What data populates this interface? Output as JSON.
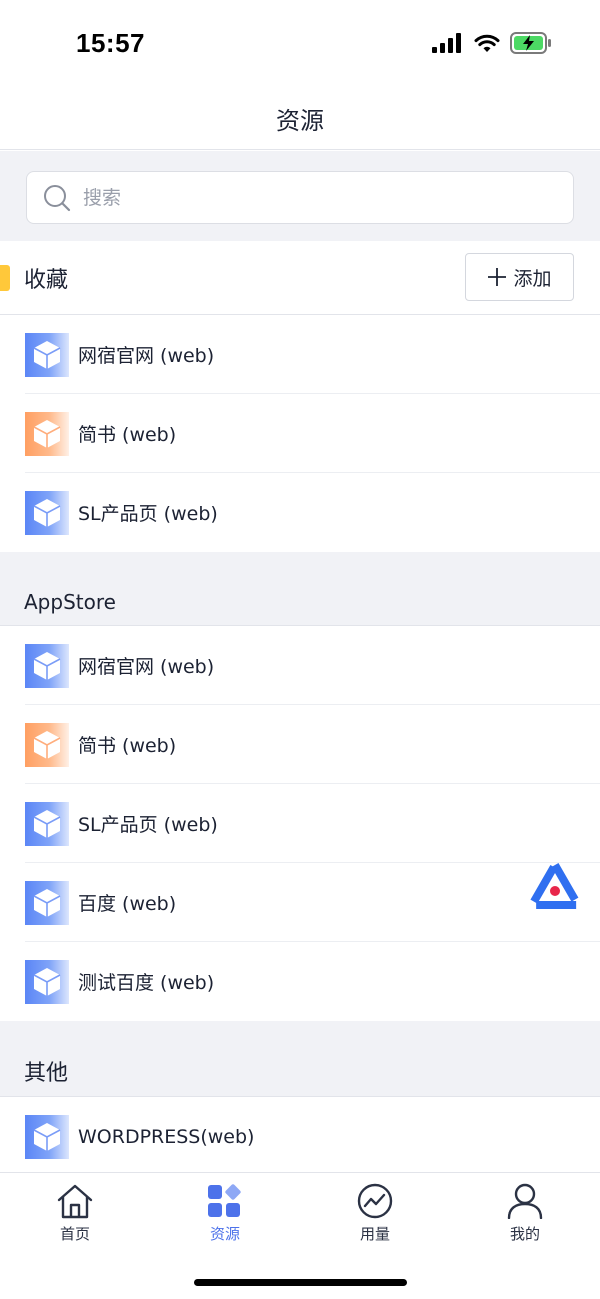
{
  "status_bar": {
    "time": "15:57"
  },
  "nav": {
    "title": "资源"
  },
  "search": {
    "placeholder": "搜索"
  },
  "favorites": {
    "title": "收藏",
    "add_label": "添加",
    "items": [
      {
        "label": "网宿官网 (web)",
        "icon_color": "blue"
      },
      {
        "label": "简书 (web)",
        "icon_color": "orange"
      },
      {
        "label": "SL产品页 (web)",
        "icon_color": "blue"
      }
    ]
  },
  "appstore": {
    "title": "AppStore",
    "items": [
      {
        "label": "网宿官网 (web)",
        "icon_color": "blue"
      },
      {
        "label": "简书 (web)",
        "icon_color": "orange"
      },
      {
        "label": "SL产品页 (web)",
        "icon_color": "blue"
      },
      {
        "label": "百度 (web)",
        "icon_color": "blue"
      },
      {
        "label": "测试百度 (web)",
        "icon_color": "blue"
      }
    ]
  },
  "other": {
    "title": "其他",
    "items": [
      {
        "label": "WORDPRESS(web)",
        "icon_color": "blue"
      }
    ]
  },
  "tabs": [
    {
      "label": "首页",
      "icon": "home-icon",
      "active": false
    },
    {
      "label": "资源",
      "icon": "apps-icon",
      "active": true
    },
    {
      "label": "用量",
      "icon": "chart-icon",
      "active": false
    },
    {
      "label": "我的",
      "icon": "user-icon",
      "active": false
    }
  ],
  "colors": {
    "accent": "#4d72ea",
    "favorites_marker": "#ffc83a",
    "icon_blue": "#5b86f6",
    "icon_orange": "#ff9f62",
    "background": "#f1f2f6"
  }
}
